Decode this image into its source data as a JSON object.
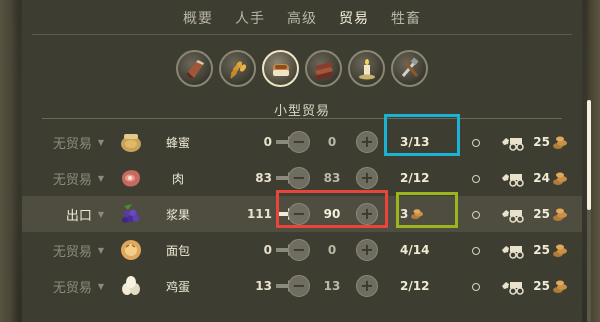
{
  "tabs": [
    {
      "label": "概要",
      "active": false
    },
    {
      "label": "人手",
      "active": false
    },
    {
      "label": "高级",
      "active": false
    },
    {
      "label": "贸易",
      "active": true
    },
    {
      "label": "牲畜",
      "active": false
    }
  ],
  "categories": [
    {
      "icon": "meat-icon",
      "active": false
    },
    {
      "icon": "wheat-icon",
      "active": false
    },
    {
      "icon": "bread-icon",
      "active": true
    },
    {
      "icon": "leather-icon",
      "active": false
    },
    {
      "icon": "candle-icon",
      "active": false
    },
    {
      "icon": "tools-icon",
      "active": false
    }
  ],
  "section": {
    "title": "小型贸易"
  },
  "rows": [
    {
      "mode": "无贸易",
      "item": "蜂蜜",
      "icon": "honey-pot-icon",
      "stock": "0",
      "target": "0",
      "trade": "3/13",
      "price": "25"
    },
    {
      "mode": "无贸易",
      "item": "肉",
      "icon": "meat-icon",
      "stock": "83",
      "target": "83",
      "trade": "2/12",
      "price": "24"
    },
    {
      "mode": "出口",
      "item": "浆果",
      "icon": "berries-icon",
      "stock": "111",
      "target": "90",
      "trade": "3",
      "price": "25"
    },
    {
      "mode": "无贸易",
      "item": "面包",
      "icon": "bread-icon",
      "stock": "0",
      "target": "0",
      "trade": "4/14",
      "price": "25"
    },
    {
      "mode": "无贸易",
      "item": "鸡蛋",
      "icon": "eggs-icon",
      "stock": "13",
      "target": "13",
      "trade": "2/12",
      "price": "25"
    }
  ],
  "annotation_colors": {
    "cyan": "#1ab3d6",
    "red": "#e8453c",
    "green": "#9ab51e"
  },
  "colors": {
    "panel": "#3e3d32",
    "text": "#f0ead6",
    "muted": "#8f8b7c"
  }
}
